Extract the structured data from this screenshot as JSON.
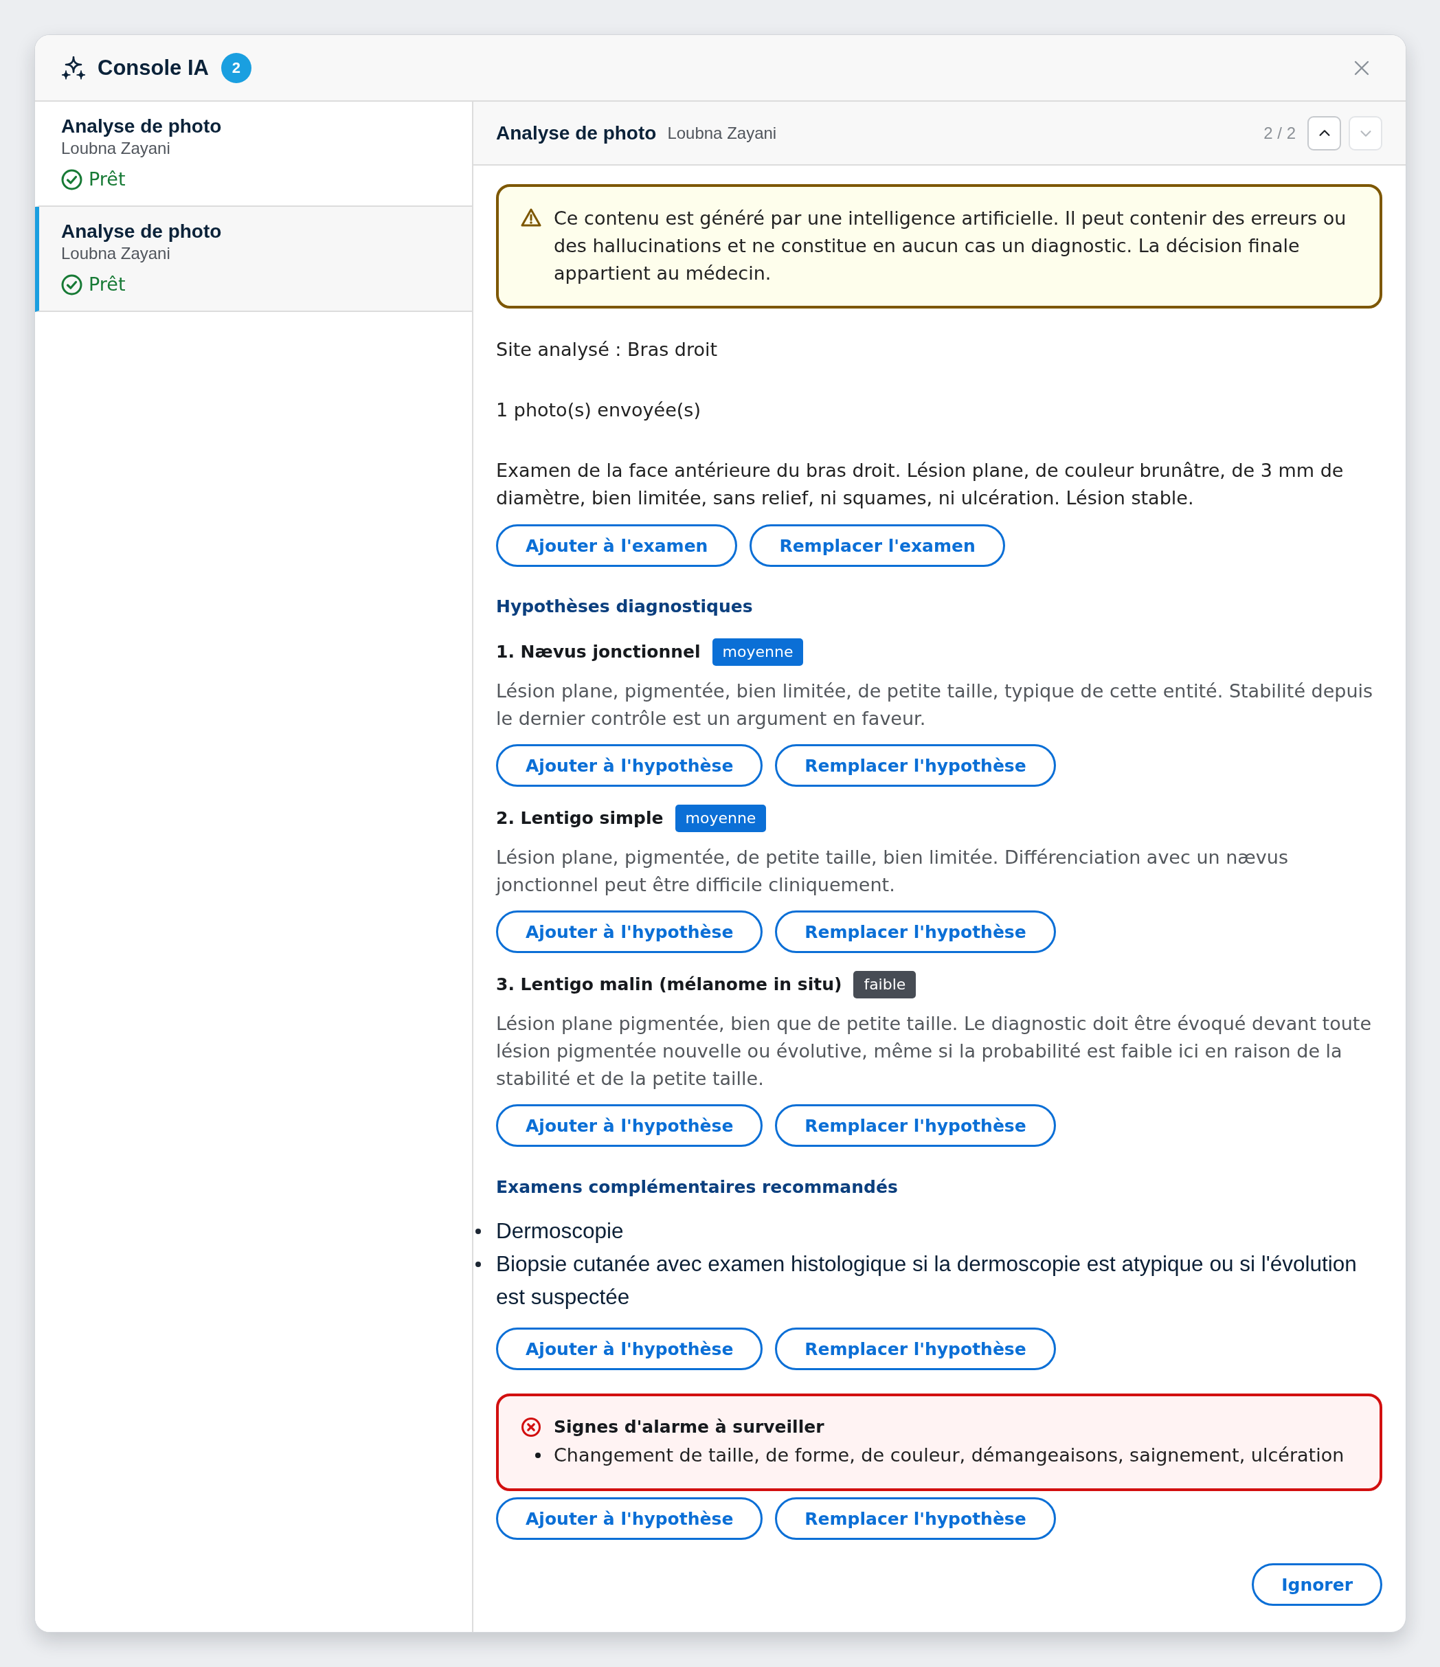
{
  "window": {
    "title": "Console IA",
    "badge": "2"
  },
  "sidebar": {
    "items": [
      {
        "title": "Analyse de photo",
        "patient": "Loubna Zayani",
        "status": "Prêt",
        "selected": false
      },
      {
        "title": "Analyse de photo",
        "patient": "Loubna Zayani",
        "status": "Prêt",
        "selected": true
      }
    ]
  },
  "detail": {
    "title": "Analyse de photo",
    "patient": "Loubna Zayani",
    "pager": "2 / 2",
    "nav": [
      {
        "kind": "up",
        "disabled": false
      },
      {
        "kind": "down",
        "disabled": true
      }
    ]
  },
  "warning": "Ce contenu est généré par une intelligence artificielle. Il peut contenir des erreurs ou des hallucinations et ne constitue en aucun cas un diagnostic. La décision finale appartient au médecin.",
  "site": "Site analysé : Bras droit",
  "photos": "1 photo(s) envoyée(s)",
  "exam": {
    "text": "Examen de la face antérieure du bras droit. Lésion plane, de couleur brunâtre, de 3 mm de diamètre, bien limitée, sans relief, ni squames, ni ulcération. Lésion stable.",
    "actions": [
      "Ajouter à l'examen",
      "Remplacer l'examen"
    ]
  },
  "hypotheses": {
    "heading": "Hypothèses diagnostiques",
    "items": [
      {
        "title": "1. Nævus jonctionnel",
        "likelihood": "moyenne",
        "color": "#0b6fd6",
        "text": "Lésion plane, pigmentée, bien limitée, de petite taille, typique de cette entité. Stabilité depuis le dernier contrôle est un argument en faveur.",
        "actions": [
          "Ajouter à l'hypothèse",
          "Remplacer l'hypothèse"
        ]
      },
      {
        "title": "2. Lentigo simple",
        "likelihood": "moyenne",
        "color": "#0b6fd6",
        "text": "Lésion plane, pigmentée, de petite taille, bien limitée. Différenciation avec un nævus jonctionnel peut être difficile cliniquement.",
        "actions": [
          "Ajouter à l'hypothèse",
          "Remplacer l'hypothèse"
        ]
      },
      {
        "title": "3. Lentigo malin (mélanome in situ)",
        "likelihood": "faible",
        "color": "#474c54",
        "text": "Lésion plane pigmentée, bien que de petite taille. Le diagnostic doit être évoqué devant toute lésion pigmentée nouvelle ou évolutive, même si la probabilité est faible ici en raison de la stabilité et de la petite taille.",
        "actions": [
          "Ajouter à l'hypothèse",
          "Remplacer l'hypothèse"
        ]
      }
    ]
  },
  "recommended": {
    "heading": "Examens complémentaires recommandés",
    "items": [
      "Dermoscopie",
      "Biopsie cutanée avec examen histologique si la dermoscopie est atypique ou si l'évolution est suspectée"
    ],
    "actions": [
      "Ajouter à l'hypothèse",
      "Remplacer l'hypothèse"
    ]
  },
  "alarm": {
    "title": "Signes d'alarme à surveiller",
    "items": [
      "Changement de taille, de forme, de couleur, démangeaisons, saignement, ulcération"
    ],
    "actions": [
      "Ajouter à l'hypothèse",
      "Remplacer l'hypothèse"
    ]
  },
  "dismiss": "Ignorer"
}
